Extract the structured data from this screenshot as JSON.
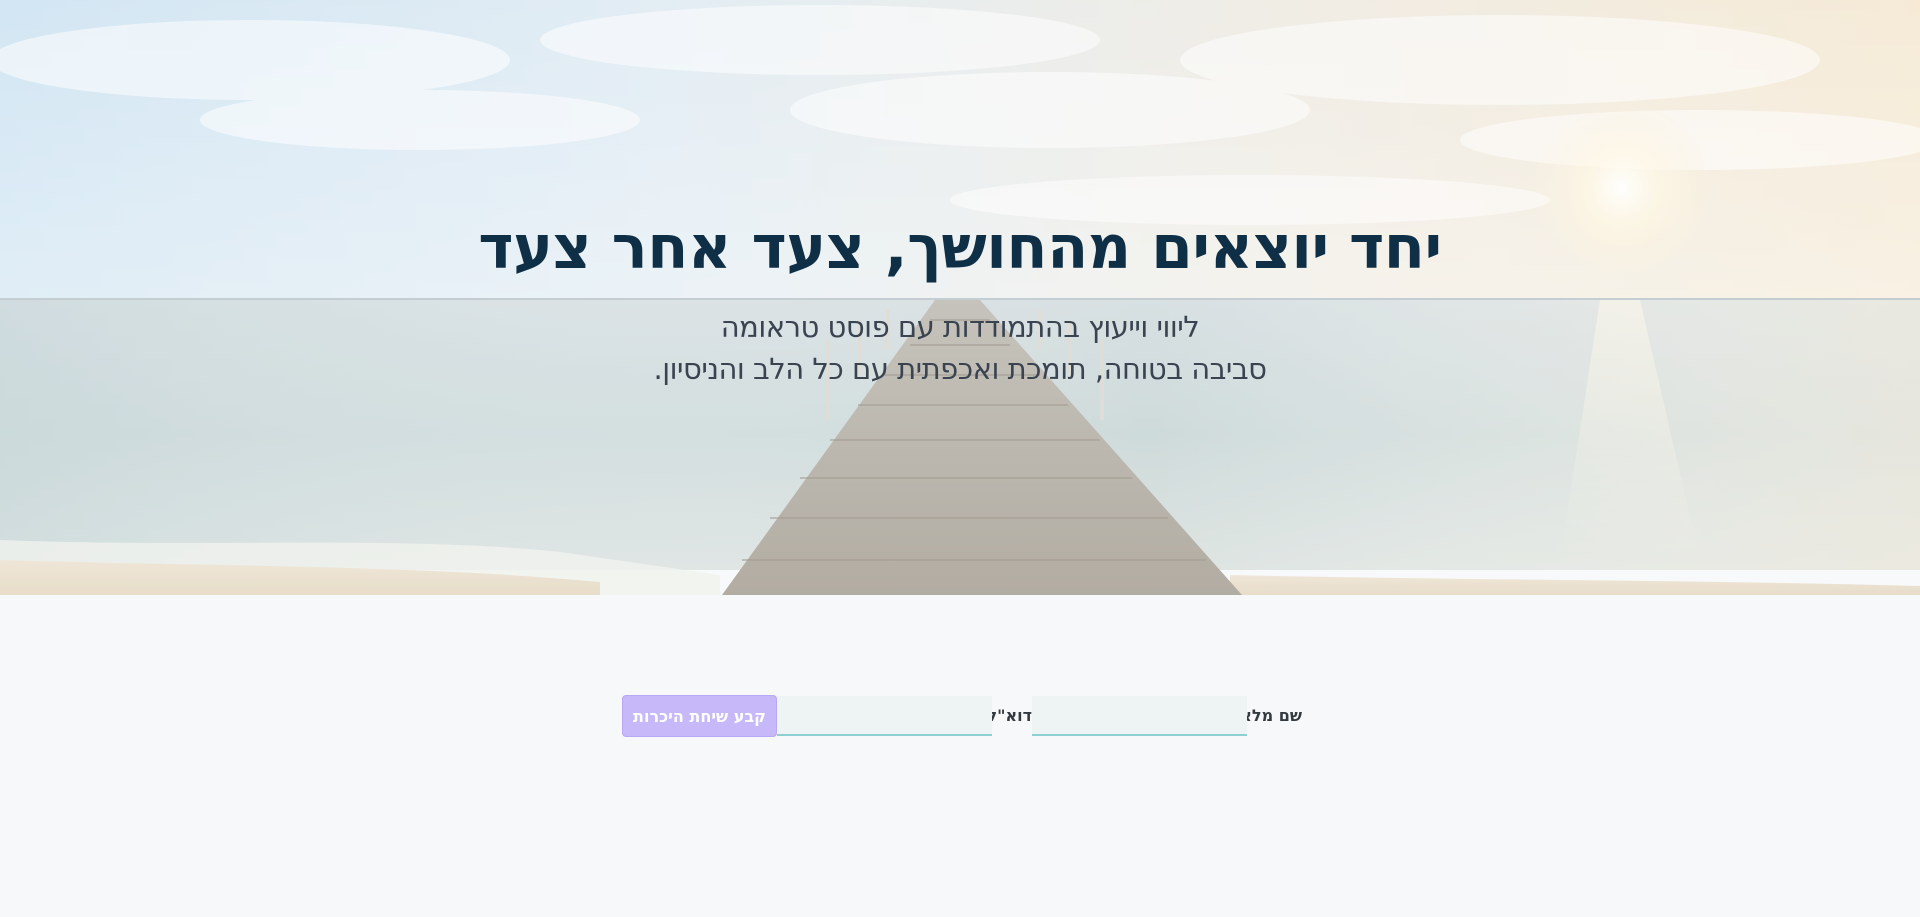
{
  "hero": {
    "title": "יחד יוצאים מהחושך, צעד אחר צעד",
    "subtitle_line1": "ליווי וייעוץ בהתמודדות עם פוסט טראומה",
    "subtitle_line2": "סביבה בטוחה, תומכת ואכפתית עם כל הלב והניסיון."
  },
  "form": {
    "name_label": "שם מלא",
    "name_value": "",
    "email_label": "דוא\"ל",
    "email_value": "",
    "submit_label": "קבע שיחת היכרות"
  },
  "colors": {
    "title": "#0f2f47",
    "subtitle": "#3a4450",
    "button": "#c7b8f9",
    "input_bg": "#eef3f4",
    "input_underline": "#8ecfd2",
    "page_bg": "#f7f8f9"
  }
}
